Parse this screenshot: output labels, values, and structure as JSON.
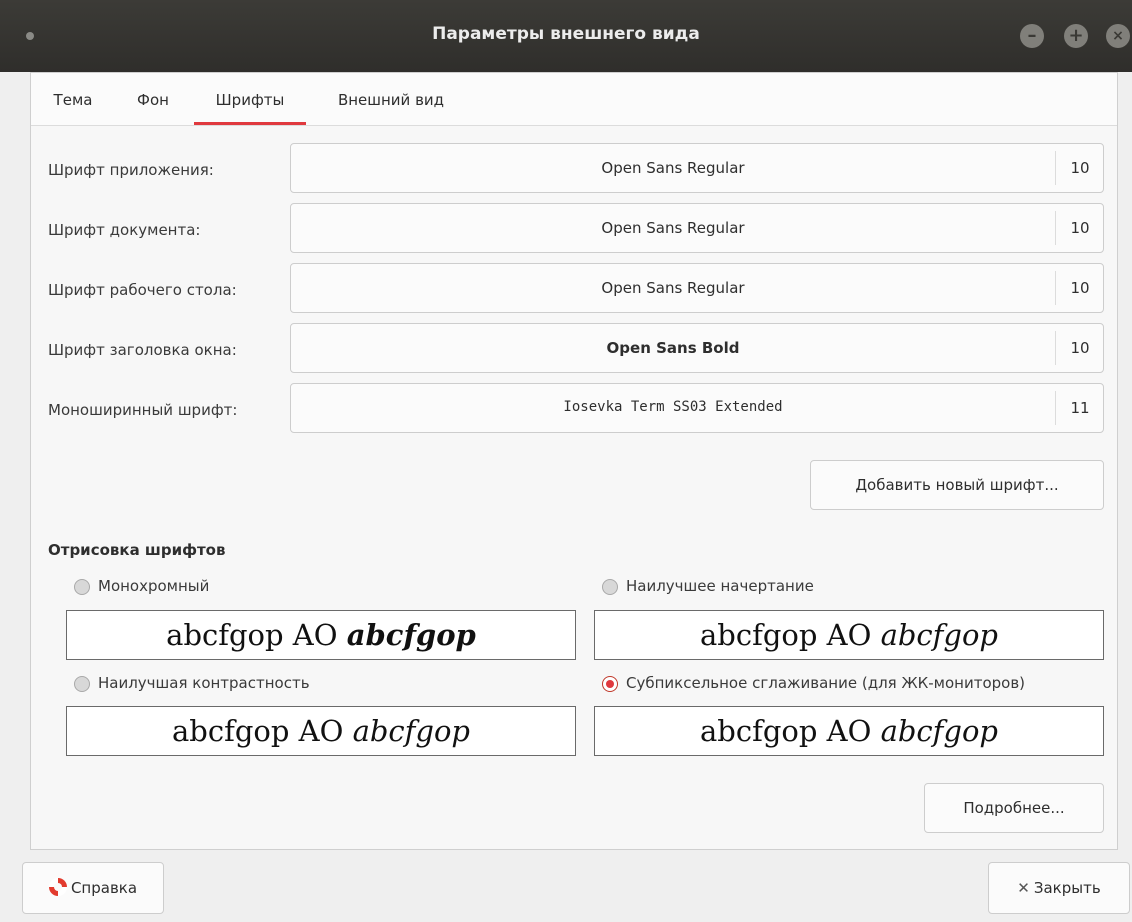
{
  "window": {
    "title": "Параметры внешнего вида"
  },
  "tabs": [
    {
      "label": "Тема",
      "active": false
    },
    {
      "label": "Фон",
      "active": false
    },
    {
      "label": "Шрифты",
      "active": true
    },
    {
      "label": "Внешний вид",
      "active": false
    }
  ],
  "fonts": [
    {
      "label": "Шрифт приложения:",
      "font": "Open Sans Regular",
      "size": "10"
    },
    {
      "label": "Шрифт документа:",
      "font": "Open Sans Regular",
      "size": "10"
    },
    {
      "label": "Шрифт рабочего стола:",
      "font": "Open Sans Regular",
      "size": "10"
    },
    {
      "label": "Шрифт заголовка окна:",
      "font": "Open Sans Bold",
      "size": "10"
    },
    {
      "label": "Моноширинный шрифт:",
      "font": "Iosevka Term SS03 Extended",
      "size": "11"
    }
  ],
  "add_font_button": "Добавить новый шрифт...",
  "rendering": {
    "title": "Отрисовка шрифтов",
    "options": [
      {
        "label": "Монохромный",
        "selected": false,
        "sample_regular": "abcfgop AO",
        "sample_italic": "abcfgop"
      },
      {
        "label": "Наилучшее начертание",
        "selected": false,
        "sample_regular": "abcfgop AO",
        "sample_italic": "abcfgop"
      },
      {
        "label": "Наилучшая контрастность",
        "selected": false,
        "sample_regular": "abcfgop AO",
        "sample_italic": "abcfgop"
      },
      {
        "label": "Субпиксельное сглаживание (для ЖК-мониторов)",
        "selected": true,
        "sample_regular": "abcfgop AO",
        "sample_italic": "abcfgop"
      }
    ]
  },
  "details_button": "Подробнее...",
  "footer": {
    "help_label": "Справка",
    "close_label": "Закрыть"
  },
  "icons": {
    "minimize": "minimize-icon",
    "maximize": "maximize-icon",
    "close": "close-icon",
    "help": "help-lifebuoy-icon",
    "close_x": "close-x-icon"
  },
  "colors": {
    "accent": "#e0393e",
    "titlebar": "#3c3b37"
  }
}
